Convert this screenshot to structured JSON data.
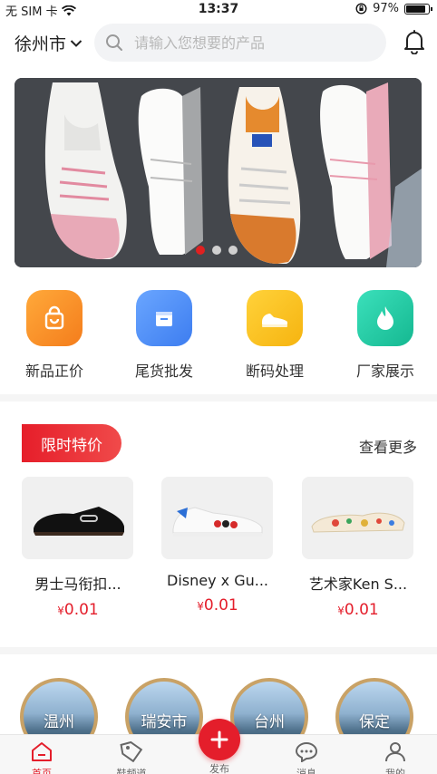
{
  "status_bar": {
    "carrier": "无 SIM 卡",
    "time": "13:37",
    "battery": "97%"
  },
  "header": {
    "city": "徐州市",
    "search_placeholder": "请输入您想要的产品"
  },
  "banner": {
    "slides": 3,
    "active_slide": 1
  },
  "categories": [
    {
      "label": "新品正价",
      "icon": "bag-icon",
      "color": "#f7922b"
    },
    {
      "label": "尾货批发",
      "icon": "box-icon",
      "color": "#4d8ef7"
    },
    {
      "label": "断码处理",
      "icon": "sneaker-icon",
      "color": "#f8c21c"
    },
    {
      "label": "厂家展示",
      "icon": "flame-icon",
      "color": "#23c9a4"
    }
  ],
  "flash_sale": {
    "title": "限时特价",
    "more": "查看更多",
    "products": [
      {
        "name": "男士马衔扣...",
        "currency": "¥",
        "price": "0.01"
      },
      {
        "name": "Disney x Gu...",
        "currency": "¥",
        "price": "0.01"
      },
      {
        "name": "艺术家Ken S...",
        "currency": "¥",
        "price": "0.01"
      }
    ]
  },
  "cities": [
    "温州",
    "瑞安市",
    "台州",
    "保定"
  ],
  "tabbar": {
    "items": [
      {
        "label": "首页",
        "icon": "home-icon"
      },
      {
        "label": "鞋频道",
        "icon": "shoe-tag-icon"
      },
      {
        "label": "发布",
        "icon": "plus-icon"
      },
      {
        "label": "消息",
        "icon": "chat-icon"
      },
      {
        "label": "我的",
        "icon": "user-icon"
      }
    ]
  },
  "colors": {
    "accent": "#e41e2b",
    "banner_bg": "#4a4d52"
  }
}
